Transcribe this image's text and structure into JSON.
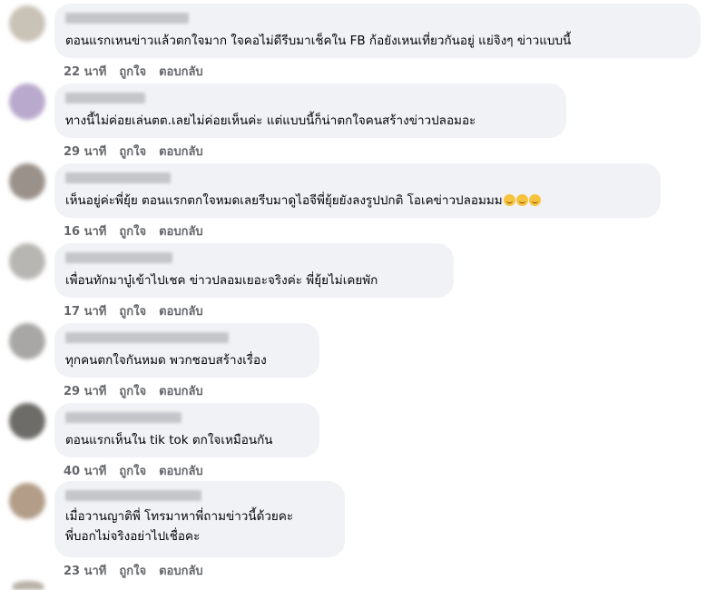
{
  "comments": [
    {
      "text": "ตอนแรกเหนข่าวแล้วตกใจมาก ใจคอไม่ดีรีบมาเช็คใน FB ก้อยังเหนเที่ยวกันอยู่ แย่จิงๆ ข่าวแบบนี้",
      "time": "22 นาที",
      "like": "ถูกใจ",
      "reply": "ตอบกลับ",
      "avatar_color": "#c9c2b6"
    },
    {
      "text": "ทางนี้ไม่ค่อยเล่นตต.เลยไม่ค่อยเห็นค่ะ แต่แบบนี้ก็น่าตกใจคนสร้างข่าวปลอมอะ",
      "time": "29 นาที",
      "like": "ถูกใจ",
      "reply": "ตอบกลับ",
      "avatar_color": "#b9a9cc"
    },
    {
      "text": "เห็นอยู่ค่ะพี่ยุ้ย ตอนแรกตกใจหมดเลยรีบมาดูไอจีพี่ยุ้ยยังลงรูปปกติ โอเคข่าวปลอมมม",
      "time": "16 นาที",
      "like": "ถูกใจ",
      "reply": "ตอบกลับ",
      "avatar_color": "#9a918a"
    },
    {
      "text": "เพื่อนทักมาบู๋เข้าไปเชค ข่าวปลอมเยอะจริงค่ะ พี่ยุ้ยไม่เคยพัก",
      "time": "17 นาที",
      "like": "ถูกใจ",
      "reply": "ตอบกลับ",
      "avatar_color": "#b8b6b2"
    },
    {
      "text": "ทุกคนตกใจกันหมด พวกชอบสร้างเรื่อง",
      "time": "29 นาที",
      "like": "ถูกใจ",
      "reply": "ตอบกลับ",
      "avatar_color": "#a8a7a5"
    },
    {
      "text": "ตอนแรกเห็นใน tik tok ตกใจเหมือนกัน",
      "time": "40 นาที",
      "like": "ถูกใจ",
      "reply": "ตอบกลับ",
      "avatar_color": "#6e6c69"
    },
    {
      "text": "เมื่อวานญาติพี่ โทรมาหาพี่ถามข่าวนี้ด้วยคะ",
      "text2": "พี่บอกไม่จริงอย่าไปเชื่อคะ",
      "time": "23 นาที",
      "like": "ถูกใจ",
      "reply": "ตอบกลับ",
      "avatar_color": "#b39d88"
    }
  ],
  "icons": {
    "emoji": "sad-face-emoji"
  }
}
